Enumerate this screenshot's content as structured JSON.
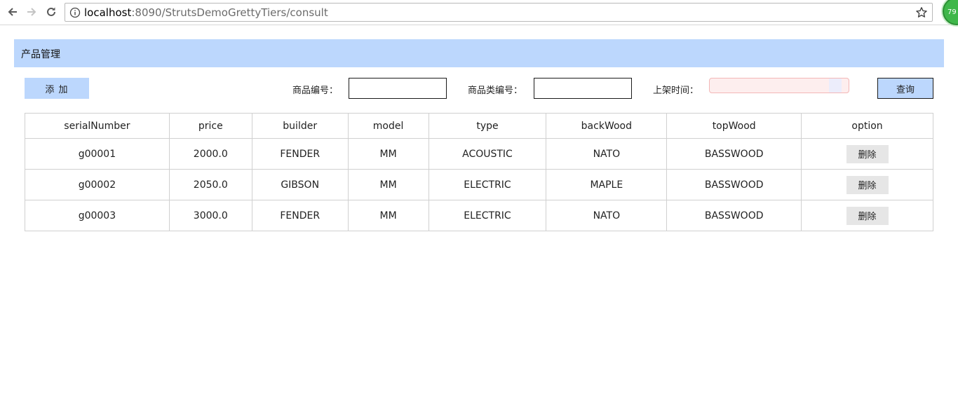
{
  "browser": {
    "url_host": "localhost",
    "url_rest": ":8090/StrutsDemoGrettyTiers/consult",
    "extension_badge": "79"
  },
  "panel": {
    "title": "产品管理"
  },
  "toolbar": {
    "add_label": "添 加",
    "serial_label": "商品编号：",
    "serial_value": "",
    "type_label": "商品类编号：",
    "type_value": "",
    "date_label": "上架时间：",
    "date_value": "",
    "query_label": "查询"
  },
  "table": {
    "columns": [
      "serialNumber",
      "price",
      "builder",
      "model",
      "type",
      "backWood",
      "topWood",
      "option"
    ],
    "delete_label": "删除",
    "rows": [
      {
        "serialNumber": "g00001",
        "price": "2000.0",
        "builder": "FENDER",
        "model": "MM",
        "type": "ACOUSTIC",
        "backWood": "NATO",
        "topWood": "BASSWOOD"
      },
      {
        "serialNumber": "g00002",
        "price": "2050.0",
        "builder": "GIBSON",
        "model": "MM",
        "type": "ELECTRIC",
        "backWood": "MAPLE",
        "topWood": "BASSWOOD"
      },
      {
        "serialNumber": "g00003",
        "price": "3000.0",
        "builder": "FENDER",
        "model": "MM",
        "type": "ELECTRIC",
        "backWood": "NATO",
        "topWood": "BASSWOOD"
      }
    ]
  },
  "colors": {
    "accent": "#bcd7fd",
    "date_bg": "#fdeeee",
    "delete_bg": "#e6e6e6"
  }
}
